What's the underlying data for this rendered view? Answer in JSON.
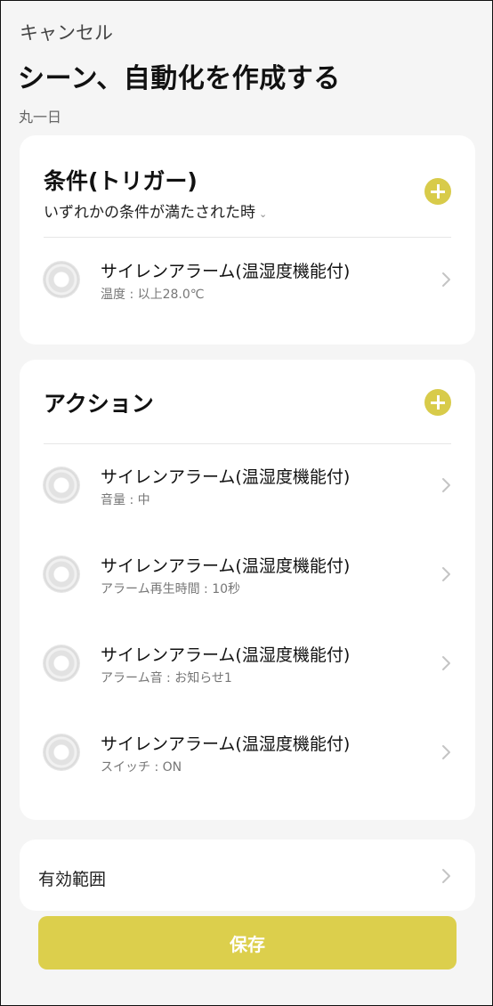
{
  "header": {
    "cancel_label": "キャンセル",
    "title": "シーン、自動化を作成する",
    "subtitle": "丸一日"
  },
  "conditions": {
    "title": "条件(トリガー)",
    "mode_label": "いずれかの条件が満たされた時",
    "items": [
      {
        "name": "サイレンアラーム(温湿度機能付)",
        "detail": "温度 : 以上28.0℃"
      }
    ]
  },
  "actions": {
    "title": "アクション",
    "items": [
      {
        "name": "サイレンアラーム(温湿度機能付)",
        "detail": "音量 : 中"
      },
      {
        "name": "サイレンアラーム(温湿度機能付)",
        "detail": "アラーム再生時間 : 10秒"
      },
      {
        "name": "サイレンアラーム(温湿度機能付)",
        "detail": "アラーム音 : お知らせ1"
      },
      {
        "name": "サイレンアラーム(温湿度機能付)",
        "detail": "スイッチ : ON"
      }
    ]
  },
  "scope": {
    "label": "有効範囲"
  },
  "save_label": "保存",
  "colors": {
    "accent": "#d8cb4a",
    "background": "#f5f5f5",
    "card": "#ffffff"
  },
  "icons": {
    "add": "plus-circle-icon",
    "chevron": "chevron-right-icon",
    "device": "siren-alarm-device-icon",
    "dropdown": "chevron-down-icon"
  }
}
